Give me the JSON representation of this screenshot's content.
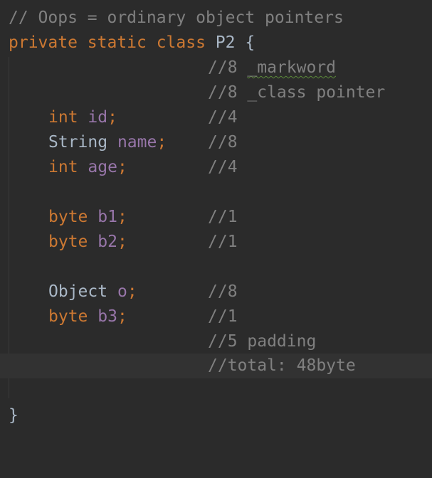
{
  "header_comment": "// Oops = ordinary object pointers",
  "class_decl": {
    "modifiers": "private static class ",
    "name": "P2",
    "open_brace": " {"
  },
  "header_comments": [
    {
      "size": "//8 ",
      "text": "_markword"
    },
    {
      "size": "//8 ",
      "text": "_class pointer"
    }
  ],
  "fields": [
    {
      "type": "int",
      "name": "id",
      "size_comment": "//4"
    },
    {
      "type": "String",
      "name": "name",
      "size_comment": "//8"
    },
    {
      "type": "int",
      "name": "age",
      "size_comment": "//4"
    },
    {
      "type": "byte",
      "name": "b1",
      "size_comment": "//1"
    },
    {
      "type": "byte",
      "name": "b2",
      "size_comment": "//1"
    },
    {
      "type": "Object",
      "name": "o",
      "size_comment": "//8"
    },
    {
      "type": "byte",
      "name": "b3",
      "size_comment": "//1"
    }
  ],
  "padding_comment": "//5 padding",
  "total_comment": "//total: 48byte",
  "close_brace": "}",
  "colors": {
    "background": "#2b2b2b",
    "keyword": "#cc7832",
    "identifier": "#a9b7c6",
    "field": "#9876aa",
    "comment": "#808080",
    "current_line": "#323232"
  }
}
